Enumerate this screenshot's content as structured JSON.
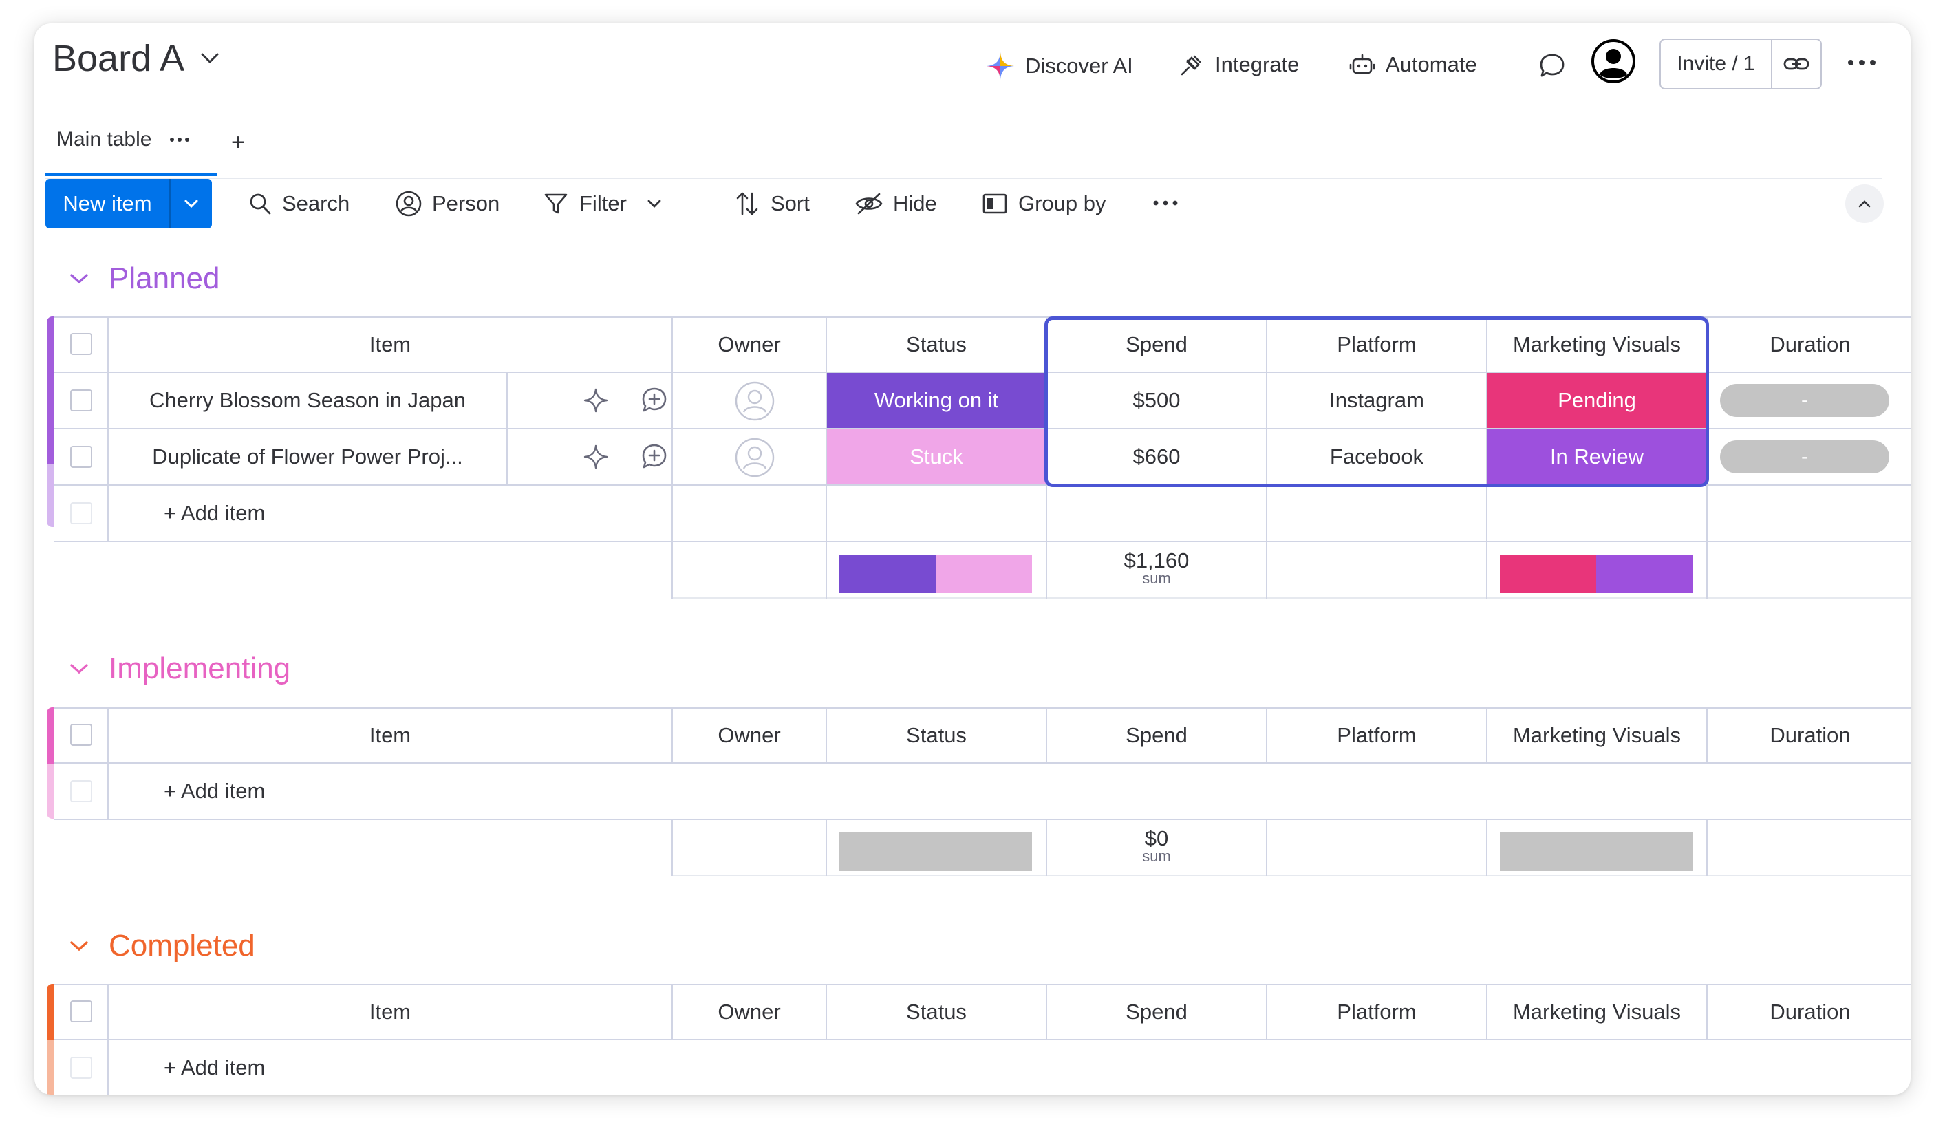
{
  "header": {
    "board_title": "Board A",
    "discover_ai": "Discover AI",
    "integrate": "Integrate",
    "automate": "Automate",
    "invite": "Invite / 1"
  },
  "tabs": {
    "main_table": "Main table",
    "add": "+"
  },
  "toolbar": {
    "new_item": "New item",
    "search": "Search",
    "person": "Person",
    "filter": "Filter",
    "sort": "Sort",
    "hide": "Hide",
    "group_by": "Group by"
  },
  "columns": [
    "Item",
    "Owner",
    "Status",
    "Spend",
    "Platform",
    "Marketing Visuals",
    "Duration"
  ],
  "colors": {
    "planned": "#a25ddc",
    "implementing": "#e762c2",
    "completed": "#f0652c",
    "working_on_it": "#784bd1",
    "stuck": "#f0a6e8",
    "pending": "#e8357a",
    "in_review": "#9d50dd",
    "empty_summary": "#c4c4c4",
    "accent": "#0073ea"
  },
  "groups": [
    {
      "name": "Planned",
      "rows": [
        {
          "item": "Cherry Blossom Season in Japan",
          "status": "Working on it",
          "spend": "$500",
          "platform": "Instagram",
          "visuals": "Pending",
          "duration": "-"
        },
        {
          "item": "Duplicate of Flower Power Proj...",
          "status": "Stuck",
          "spend": "$660",
          "platform": "Facebook",
          "visuals": "In Review",
          "duration": "-"
        }
      ],
      "add_item": "+ Add item",
      "spend_sum": "$1,160",
      "sum_label": "sum"
    },
    {
      "name": "Implementing",
      "add_item": "+ Add item",
      "spend_sum": "$0",
      "sum_label": "sum"
    },
    {
      "name": "Completed",
      "add_item": "+ Add item"
    }
  ]
}
